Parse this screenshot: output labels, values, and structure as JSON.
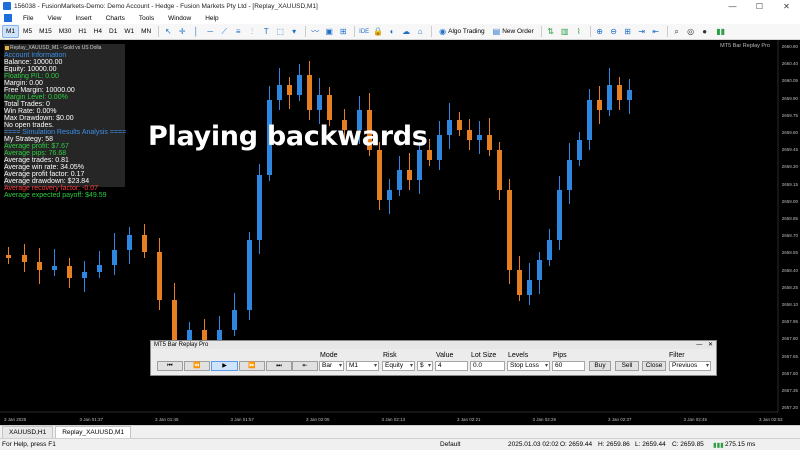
{
  "titlebar": {
    "title": "156038 - FusionMarkets-Demo: Demo Account - Hedge - Fusion Markets Pty Ltd - [Replay_XAUUSD,M1]",
    "minimize": "—",
    "maximize": "☐",
    "close": "✕"
  },
  "menu": [
    "File",
    "View",
    "Insert",
    "Charts",
    "Tools",
    "Window",
    "Help"
  ],
  "toolbar": {
    "timeframes": [
      "M1",
      "M5",
      "M15",
      "M30",
      "H1",
      "H4",
      "D1",
      "W1",
      "MN"
    ],
    "active_timeframe": "M1",
    "ide_label": "IDE",
    "algo_trading": "Algo Trading",
    "new_order": "New Order"
  },
  "chart": {
    "label": "MT5 Bar Replay Pro",
    "overlay_text": "Playing backwards",
    "info": {
      "header": "Replay_XAUUSD_M1 - Gold vs US Dolla",
      "rows": [
        {
          "text": "Account Information",
          "color": "b"
        },
        {
          "text": "Balance: 10000.00",
          "color": "w"
        },
        {
          "text": "Equity: 10000.00",
          "color": "w"
        },
        {
          "text": "Floating P/L: 0.00",
          "color": "g"
        },
        {
          "text": "Margin: 0.00",
          "color": "w"
        },
        {
          "text": "Free Margin: 10000.00",
          "color": "w"
        },
        {
          "text": "Margin Level: 0.00%",
          "color": "g"
        },
        {
          "text": "Total Trades: 0",
          "color": "w"
        },
        {
          "text": "Win Rate: 0.00%",
          "color": "w"
        },
        {
          "text": "Max Drawdown: $0.00",
          "color": "w"
        },
        {
          "text": "No open trades.",
          "color": "w"
        },
        {
          "text": "==== Simulation Results Analysis ====",
          "color": "b"
        },
        {
          "text": "My Strategy: 58",
          "color": "w"
        },
        {
          "text": "Average profit: $7.67",
          "color": "g"
        },
        {
          "text": "Average pips: 76.68",
          "color": "g"
        },
        {
          "text": "Average trades: 0.81",
          "color": "w"
        },
        {
          "text": "Average win rate: 34.05%",
          "color": "w"
        },
        {
          "text": "Average profit factor: 0.17",
          "color": "w"
        },
        {
          "text": "Average drawdown: $23.84",
          "color": "w"
        },
        {
          "text": "Average recovery factor: -0.07",
          "color": "r"
        },
        {
          "text": "Average expected payoff: $49.59",
          "color": "g"
        }
      ]
    },
    "y_ticks": [
      "2660.80",
      "2660.40",
      "2660.05",
      "2659.90",
      "2659.75",
      "2659.60",
      "2659.45",
      "2659.30",
      "2659.15",
      "2659.00",
      "2658.85",
      "2658.70",
      "2658.55",
      "2658.40",
      "2658.25",
      "2658.10",
      "2657.95",
      "2657.80",
      "2657.65",
      "2657.50",
      "2657.35",
      "2657.20"
    ],
    "x_ticks": [
      "3 Jan 2025",
      "3 Jan 01:37",
      "3 Jan 01:45",
      "3 Jan 01:57",
      "3 Jan 02:05",
      "3 Jan 02:13",
      "3 Jan 02:21",
      "3 Jan 02:29",
      "3 Jan 02:37",
      "3 Jan 02:45",
      "3 Jan 02:53"
    ],
    "colors": {
      "up": "#2e86de",
      "down": "#e67e22",
      "background": "#000000"
    }
  },
  "replay": {
    "title": "MT5 Bar Replay Pro",
    "labels": {
      "mode": "Mode",
      "risk": "Risk",
      "value": "Value",
      "lot_size": "Lot Size",
      "levels": "Levels",
      "pips": "Pips",
      "filter": "Filter"
    },
    "transport": [
      "⏮",
      "⏪",
      "▶",
      "⏩",
      "⏭",
      "⇤"
    ],
    "mode_value": "Bar",
    "timeframe_value": "M1",
    "risk_value": "Equity",
    "currency_value": "$",
    "value": "4",
    "lot_size": "0.0",
    "levels_value": "Stop Loss",
    "pips_value": "60",
    "buy": "Buy",
    "sell": "Sell",
    "close": "Close",
    "filter_value": "Previuos"
  },
  "tabs": [
    "XAUUSD,H1",
    "Replay_XAUUSD,M1"
  ],
  "active_tab": "Replay_XAUUSD,M1",
  "status": {
    "help": "For Help, press F1",
    "profile": "Default",
    "time": "2025.01.03 02:02",
    "open": "O: 2659.44",
    "high": "H: 2659.86",
    "low": "L: 2659.44",
    "close": "C: 2659.85",
    "ping": "275.15 ms"
  }
}
